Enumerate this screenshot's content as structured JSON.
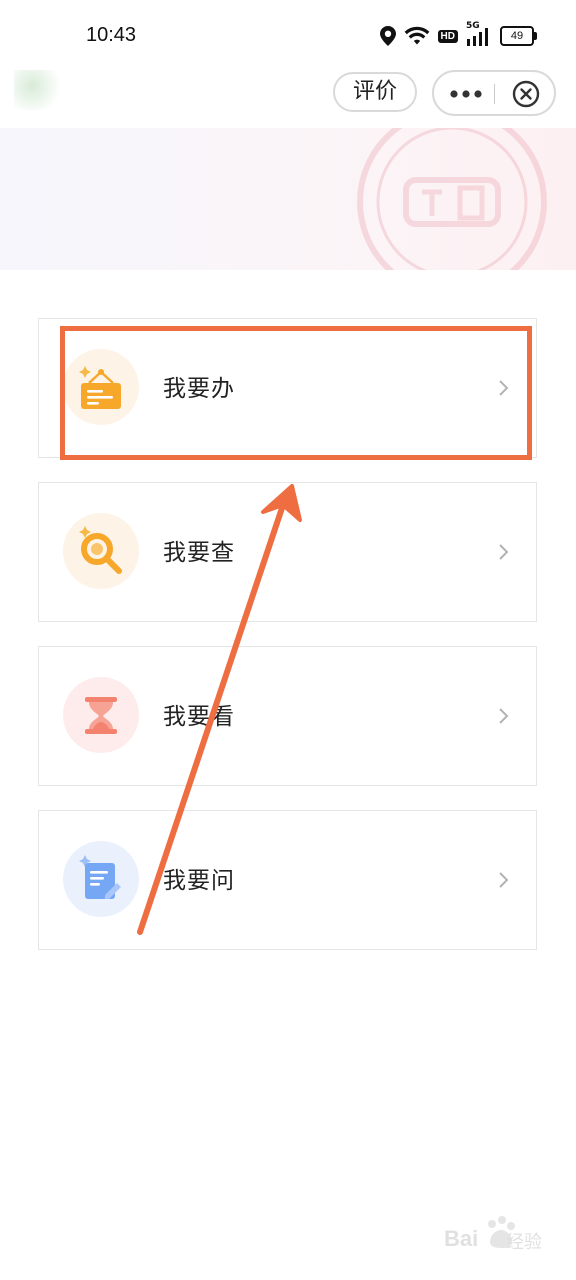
{
  "status_bar": {
    "time": "10:43",
    "network_label": "5G",
    "hd_label": "HD",
    "battery": "49"
  },
  "nav": {
    "rate_label": "评价",
    "more_icon": "more-dots-icon",
    "close_icon": "close-circle-icon"
  },
  "menu": {
    "items": [
      {
        "label": "我要办",
        "icon": "signboard-icon",
        "color": "#f7a72a",
        "bg": "#fdf3e6"
      },
      {
        "label": "我要查",
        "icon": "magnifier-icon",
        "color": "#f7a72a",
        "bg": "#fdf3e6"
      },
      {
        "label": "我要看",
        "icon": "hourglass-icon",
        "color": "#f3826e",
        "bg": "#fdeceb"
      },
      {
        "label": "我要问",
        "icon": "notepad-icon",
        "color": "#76a7f5",
        "bg": "#eaf1fd"
      }
    ]
  },
  "annotation": {
    "highlight_color": "#ee6e42",
    "highlighted_item": "我要办"
  },
  "watermark": {
    "brand": "Bai",
    "sub": "经验"
  }
}
